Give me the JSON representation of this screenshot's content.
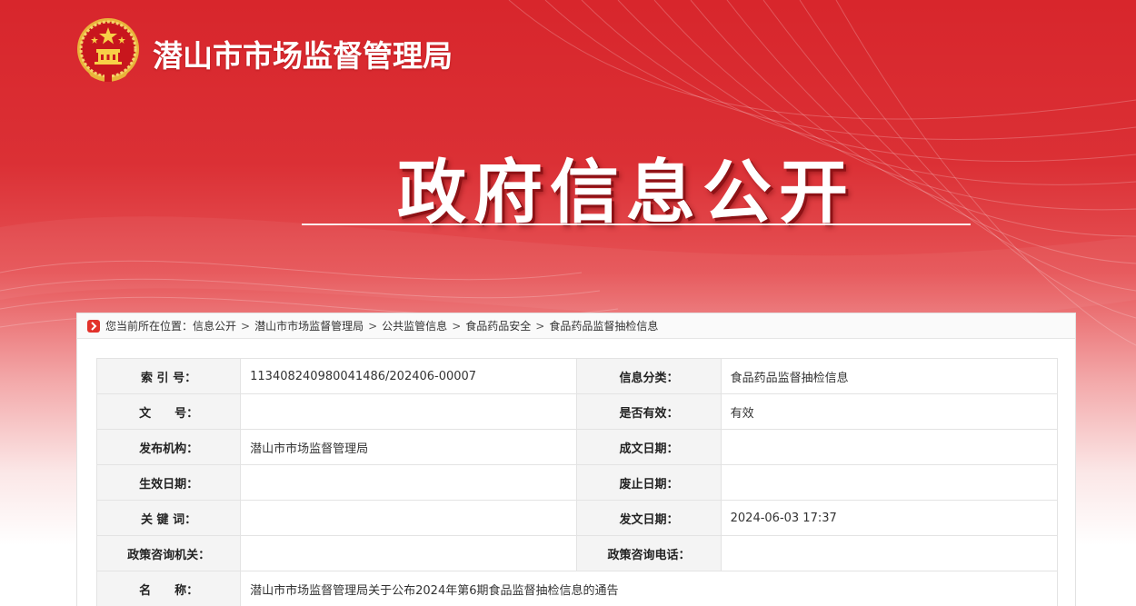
{
  "header": {
    "site_title": "潜山市市场监督管理局",
    "hero_title": "政府信息公开",
    "emblem_icon": "national-emblem-icon"
  },
  "breadcrumb": {
    "prefix": "您当前所在位置：",
    "items": [
      "信息公开",
      "潜山市市场监督管理局",
      "公共监管信息",
      "食品药品安全",
      "食品药品监督抽检信息"
    ],
    "separator": ">"
  },
  "meta": {
    "rows": [
      {
        "l1": "索 引 号：",
        "v1": "113408240980041486/202406-00007",
        "l2": "信息分类：",
        "v2": "食品药品监督抽检信息"
      },
      {
        "l1": "文　　号：",
        "v1": "",
        "l2": "是否有效：",
        "v2": "有效"
      },
      {
        "l1": "发布机构：",
        "v1": "潜山市市场监督管理局",
        "l2": "成文日期：",
        "v2": ""
      },
      {
        "l1": "生效日期：",
        "v1": "",
        "l2": "废止日期：",
        "v2": ""
      },
      {
        "l1": "关 键 词：",
        "v1": "",
        "l2": "发文日期：",
        "v2": "2024-06-03 17:37"
      },
      {
        "l1": "政策咨询机关：",
        "v1": "",
        "l2": "政策咨询电话：",
        "v2": ""
      }
    ],
    "name_label": "名　　称：",
    "name_value": "潜山市市场监督管理局关于公布2024年第6期食品监督抽检信息的通告"
  },
  "colors": {
    "brand_red": "#d8262c",
    "label_bg": "#f4f4f4",
    "crumb_icon": "#e2322b"
  }
}
